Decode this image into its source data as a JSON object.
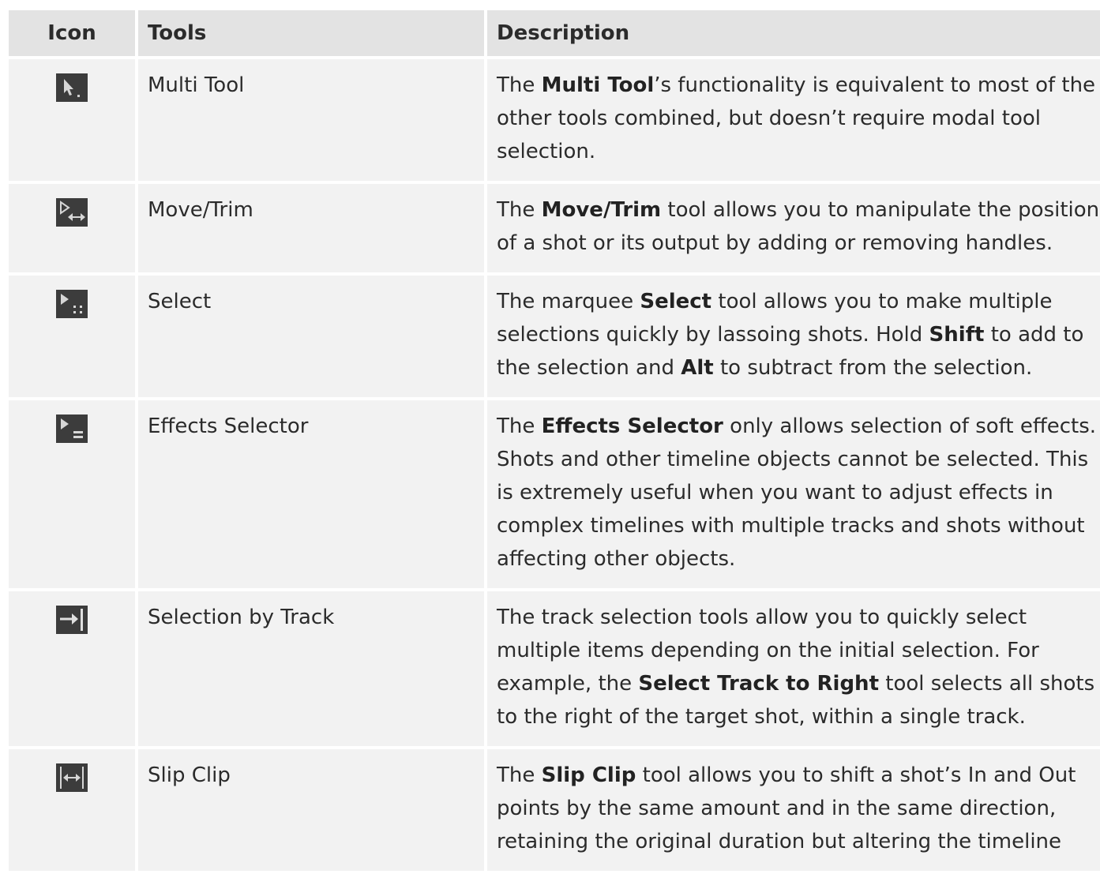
{
  "headers": {
    "icon": "Icon",
    "tools": "Tools",
    "description": "Description"
  },
  "rows": [
    {
      "icon": "multi-tool-icon",
      "name": "Multi Tool",
      "desc": [
        {
          "t": "The "
        },
        {
          "b": "Multi Tool"
        },
        {
          "t": "’s functionality is equivalent to most of the other tools combined, but doesn’t require modal tool selection."
        }
      ]
    },
    {
      "icon": "move-trim-icon",
      "name": "Move/Trim",
      "desc": [
        {
          "t": "The "
        },
        {
          "b": "Move/Trim"
        },
        {
          "t": " tool allows you to manipulate the position of a shot or its output by adding or removing handles."
        }
      ]
    },
    {
      "icon": "select-icon",
      "name": "Select",
      "desc": [
        {
          "t": "The marquee "
        },
        {
          "b": "Select"
        },
        {
          "t": " tool allows you to make multiple selections quickly by lassoing shots. Hold "
        },
        {
          "b": "Shift"
        },
        {
          "t": " to add to the selection and "
        },
        {
          "b": "Alt"
        },
        {
          "t": " to subtract from the selection."
        }
      ]
    },
    {
      "icon": "effects-selector-icon",
      "name": "Effects Selector",
      "desc": [
        {
          "t": "The "
        },
        {
          "b": "Effects Selector"
        },
        {
          "t": " only allows selection of soft effects. Shots and other timeline objects cannot be selected. This is extremely useful when you want to adjust effects in complex timelines with multiple tracks and shots without affecting other objects."
        }
      ]
    },
    {
      "icon": "select-track-right-icon",
      "name": "Selection by Track",
      "desc": [
        {
          "t": "The track selection tools allow you to quickly select multiple items depending on the initial selection. For example, the "
        },
        {
          "b": "Select Track to Right"
        },
        {
          "t": " tool selects all shots to the right of the target shot, within a single track."
        }
      ]
    },
    {
      "icon": "slip-clip-icon",
      "name": "Slip Clip",
      "desc": [
        {
          "t": "The "
        },
        {
          "b": "Slip Clip"
        },
        {
          "t": " tool allows you to shift a shot’s In and Out points by the same amount and in the same direction, retaining the original duration but altering the timeline"
        }
      ]
    }
  ]
}
